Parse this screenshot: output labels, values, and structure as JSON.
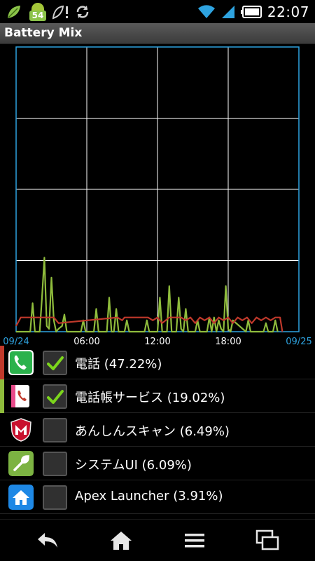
{
  "status_bar": {
    "time": "22:07",
    "notification_badge": "54",
    "icons": [
      "leaf-icon",
      "android-badge-icon",
      "leaf-alert-icon",
      "sync-icon",
      "wifi-icon",
      "signal-icon",
      "battery-icon"
    ]
  },
  "app_bar": {
    "title": "Battery Mix"
  },
  "chart_data": {
    "type": "line",
    "x_ticks": [
      "09/24",
      "06:00",
      "12:00",
      "18:00",
      "09/25"
    ],
    "x_tick_colors": [
      "#2ea3e0",
      "#ffffff",
      "#ffffff",
      "#ffffff",
      "#2ea3e0"
    ],
    "xlim": [
      0,
      24
    ],
    "ylim": [
      0,
      100
    ],
    "grid": true,
    "grid_color": "#ffffff",
    "frame_color": "#2ea3e0",
    "series": [
      {
        "color": "#8fbc3c",
        "x": [
          0,
          1.2,
          1.4,
          1.6,
          2.0,
          2.2,
          2.4,
          2.6,
          2.8,
          3.0,
          3.2,
          3.4,
          3.6,
          3.9,
          4.1,
          4.3,
          5.5,
          5.7,
          5.9,
          6.6,
          6.8,
          7.0,
          7.7,
          7.9,
          8.1,
          8.3,
          8.5,
          8.7,
          9.2,
          9.4,
          9.6,
          10.9,
          11.1,
          11.3,
          12.0,
          12.2,
          12.4,
          12.8,
          13.0,
          13.2,
          13.6,
          13.8,
          14.0,
          14.2,
          14.4,
          14.6,
          15.2,
          15.4,
          15.6,
          16.2,
          16.4,
          16.6,
          16.8,
          17.0,
          17.2,
          17.4,
          17.6,
          17.8,
          18.0,
          18.2,
          18.4,
          19.5,
          19.7,
          19.9,
          21.0,
          21.2,
          21.4,
          21.8,
          22.0,
          22.2
        ],
        "y": [
          0,
          0,
          10,
          0,
          0,
          12,
          26,
          2,
          1,
          19,
          4,
          0,
          1,
          2,
          6,
          0,
          0,
          4,
          0,
          0,
          8,
          0,
          0,
          12,
          0,
          0,
          8,
          0,
          0,
          4,
          0,
          0,
          4,
          0,
          0,
          12,
          0,
          0,
          16,
          0,
          0,
          12,
          1,
          0,
          8,
          0,
          0,
          4,
          0,
          0,
          5,
          0,
          5,
          0,
          4,
          1,
          0,
          16,
          1,
          0,
          4,
          0,
          4,
          0,
          0,
          3,
          0,
          0,
          4,
          0
        ]
      },
      {
        "color": "#c0392b",
        "x": [
          0,
          0.4,
          1.0,
          3.2,
          3.6,
          8.6,
          9.0,
          9.2,
          10.0,
          11.2,
          11.6,
          12.0,
          12.4,
          13.0,
          13.6,
          14.0,
          14.4,
          14.8,
          15.2,
          15.6,
          16.0,
          16.4,
          16.8,
          17.2,
          17.6,
          18.0,
          18.4,
          18.8,
          19.2,
          19.6,
          20.0,
          20.4,
          20.8,
          21.2,
          21.6,
          22.0,
          22.4,
          22.6
        ],
        "y": [
          2,
          5,
          5,
          5,
          3,
          5,
          4,
          5,
          5,
          5,
          4,
          5,
          3,
          5,
          5,
          5,
          4,
          5,
          3,
          5,
          4,
          5,
          3,
          5,
          4,
          5,
          3,
          5,
          4,
          5,
          3,
          5,
          4,
          5,
          4,
          5,
          5,
          0
        ]
      }
    ]
  },
  "apps": [
    {
      "label": "電話 (47.22%)",
      "checked": true,
      "color": "#c0392b",
      "icon": "phone-icon"
    },
    {
      "label": "電話帳サービス (19.02%)",
      "checked": true,
      "color": "#8fbc3c",
      "icon": "contacts-phone-icon"
    },
    {
      "label": "あんしんスキャン (6.49%)",
      "checked": false,
      "color": "",
      "icon": "mcafee-shield-icon"
    },
    {
      "label": "システムUI (6.09%)",
      "checked": false,
      "color": "",
      "icon": "wrench-icon"
    },
    {
      "label": "Apex Launcher (3.91%)",
      "checked": false,
      "color": "",
      "icon": "home-launcher-icon"
    }
  ],
  "nav": [
    "back-icon",
    "home-icon",
    "menu-icon",
    "recent-apps-icon"
  ]
}
